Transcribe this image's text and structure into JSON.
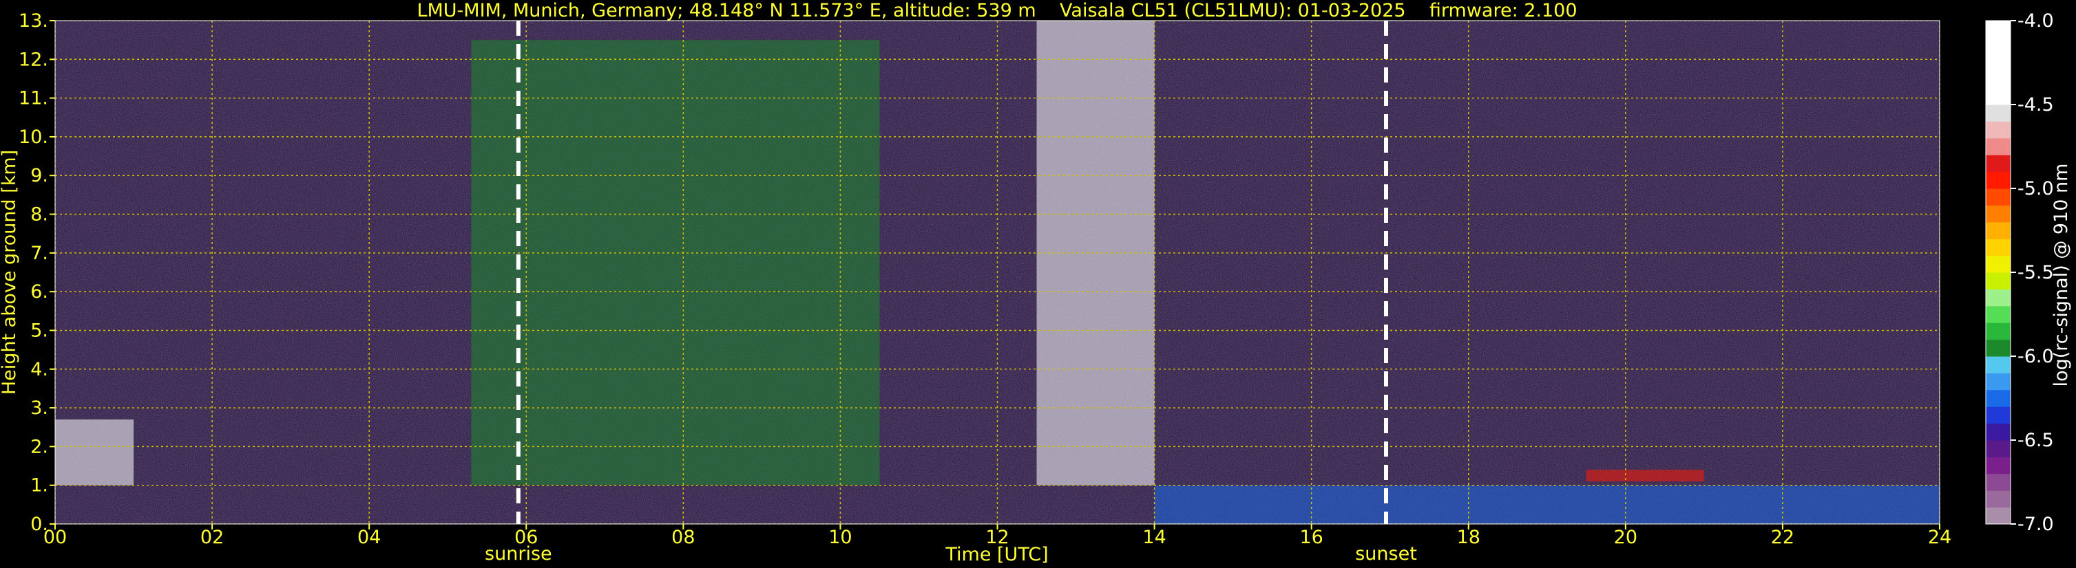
{
  "chart_data": {
    "type": "heatmap",
    "title": "LMU-MIM, Munich, Germany; 48.148° N 11.573° E, altitude: 539 m    Vaisala CL51 (CL51LMU): 01-03-2025    firmware: 2.100",
    "xlabel": "Time [UTC]",
    "ylabel": "Height above ground [km]",
    "xlim": [
      0,
      24
    ],
    "ylim": [
      0,
      13
    ],
    "x_ticks": [
      "00",
      "02",
      "04",
      "06",
      "08",
      "10",
      "12",
      "14",
      "16",
      "18",
      "20",
      "22",
      "24"
    ],
    "y_ticks": [
      "0.",
      "1.",
      "2.",
      "3.",
      "4.",
      "5.",
      "6.",
      "7.",
      "8.",
      "9.",
      "10.",
      "11.",
      "12.",
      "13."
    ],
    "grid": true,
    "markers": [
      {
        "label": "sunrise",
        "x": 5.9
      },
      {
        "label": "sunset",
        "x": 16.95
      }
    ],
    "colorbar": {
      "label": "log(rc-signal) @ 910 nm",
      "range": [
        -7.0,
        -4.0
      ],
      "ticks": [
        "-4.0",
        "-4.5",
        "-5.0",
        "-5.5",
        "-6.0",
        "-6.5",
        "-7.0"
      ]
    },
    "dominant_regions": [
      {
        "region": "enhanced signal aloft",
        "x": [
          5.3,
          10.5
        ],
        "y": [
          1.0,
          12.5
        ],
        "level": -6.0
      },
      {
        "region": "high noise (daylight)",
        "x": [
          12.5,
          14.0
        ],
        "y": [
          1.0,
          13.0
        ],
        "level": -4.5
      },
      {
        "region": "evening boundary layer",
        "x": [
          14.0,
          24.0
        ],
        "y": [
          0.0,
          1.0
        ],
        "level": -6.3
      },
      {
        "region": "elevated aerosol layer",
        "x": [
          19.5,
          21.0
        ],
        "y": [
          1.1,
          1.4
        ],
        "level": -5.0
      },
      {
        "region": "low cloud / aerosol",
        "x": [
          0.0,
          1.0
        ],
        "y": [
          1.0,
          2.7
        ],
        "level": -4.5
      }
    ]
  },
  "colors": {
    "text": "#ffff33",
    "grid": "#d4c000",
    "background": "#000000",
    "marker": "#ffffff"
  },
  "colormap": [
    "#a98ea9",
    "#9a6a9c",
    "#8c4a94",
    "#7a1f8c",
    "#5a1a8a",
    "#3a1aa0",
    "#1f3ad8",
    "#1a6ae8",
    "#3a9af0",
    "#55c8f0",
    "#1c8a2a",
    "#2ab83a",
    "#55dd55",
    "#9ef08a",
    "#c8f000",
    "#f0f000",
    "#ffd200",
    "#ffb000",
    "#ff8000",
    "#ff4a00",
    "#ff1a00",
    "#e01a1a",
    "#f08a8a",
    "#f0b8b8",
    "#e0e0e0",
    "#ffffff",
    "#ffffff",
    "#ffffff",
    "#ffffff",
    "#ffffff"
  ]
}
